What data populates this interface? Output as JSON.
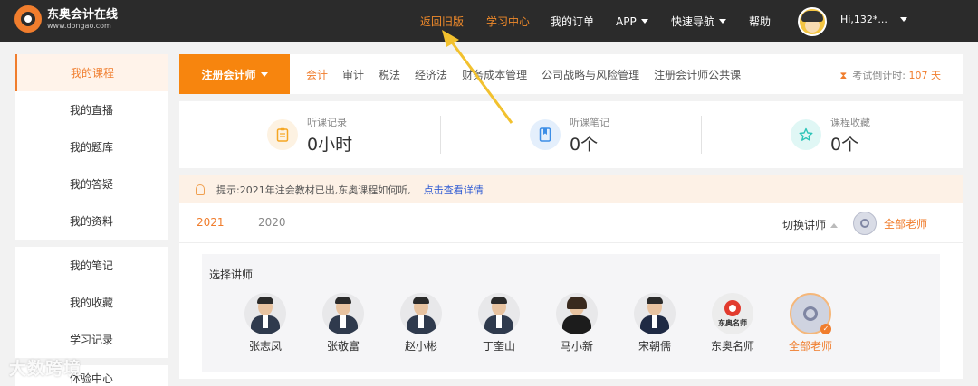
{
  "header": {
    "logo_cn": "东奥会计在线",
    "logo_url": "www.dongao.com",
    "nav": {
      "old_version": "返回旧版",
      "study_center": "学习中心",
      "my_orders": "我的订单",
      "app": "APP",
      "quick_nav": "快速导航",
      "help": "帮助"
    },
    "user_name": "Hi,132*..."
  },
  "sidebar": {
    "group1": [
      "我的课程",
      "我的直播",
      "我的题库",
      "我的答疑",
      "我的资料"
    ],
    "group2": [
      "我的笔记",
      "我的收藏",
      "学习记录"
    ],
    "stub": "体验中心"
  },
  "course_bar": {
    "selected_course": "注册会计师",
    "subjects": [
      "会计",
      "审计",
      "税法",
      "经济法",
      "财务成本管理",
      "公司战略与风险管理",
      "注册会计师公共课"
    ],
    "countdown_label": "考试倒计时:",
    "countdown_value": "107",
    "countdown_unit": "天"
  },
  "stats": [
    {
      "label": "听课记录",
      "value": "0小时",
      "color": "#f5a623"
    },
    {
      "label": "听课笔记",
      "value": "0个",
      "color": "#3d8ee6"
    },
    {
      "label": "课程收藏",
      "value": "0个",
      "color": "#2bc4b8"
    }
  ],
  "tip": {
    "text": "提示:2021年注会教材已出,东奥课程如何听,",
    "link": "点击查看详情"
  },
  "years": {
    "y2021": "2021",
    "y2020": "2020",
    "switch_teacher": "切换讲师",
    "all_teachers": "全部老师"
  },
  "teacher_panel": {
    "title": "选择讲师",
    "teachers": [
      "张志凤",
      "张敬富",
      "赵小彬",
      "丁奎山",
      "马小新",
      "宋朝儒",
      "东奥名师",
      "全部老师"
    ],
    "brand_badge": "东奥名师"
  },
  "watermark": "大数跨境",
  "colors": {
    "accent": "#f07d2d",
    "nav_bg": "#2b2b2b",
    "link": "#2f5bd3"
  }
}
